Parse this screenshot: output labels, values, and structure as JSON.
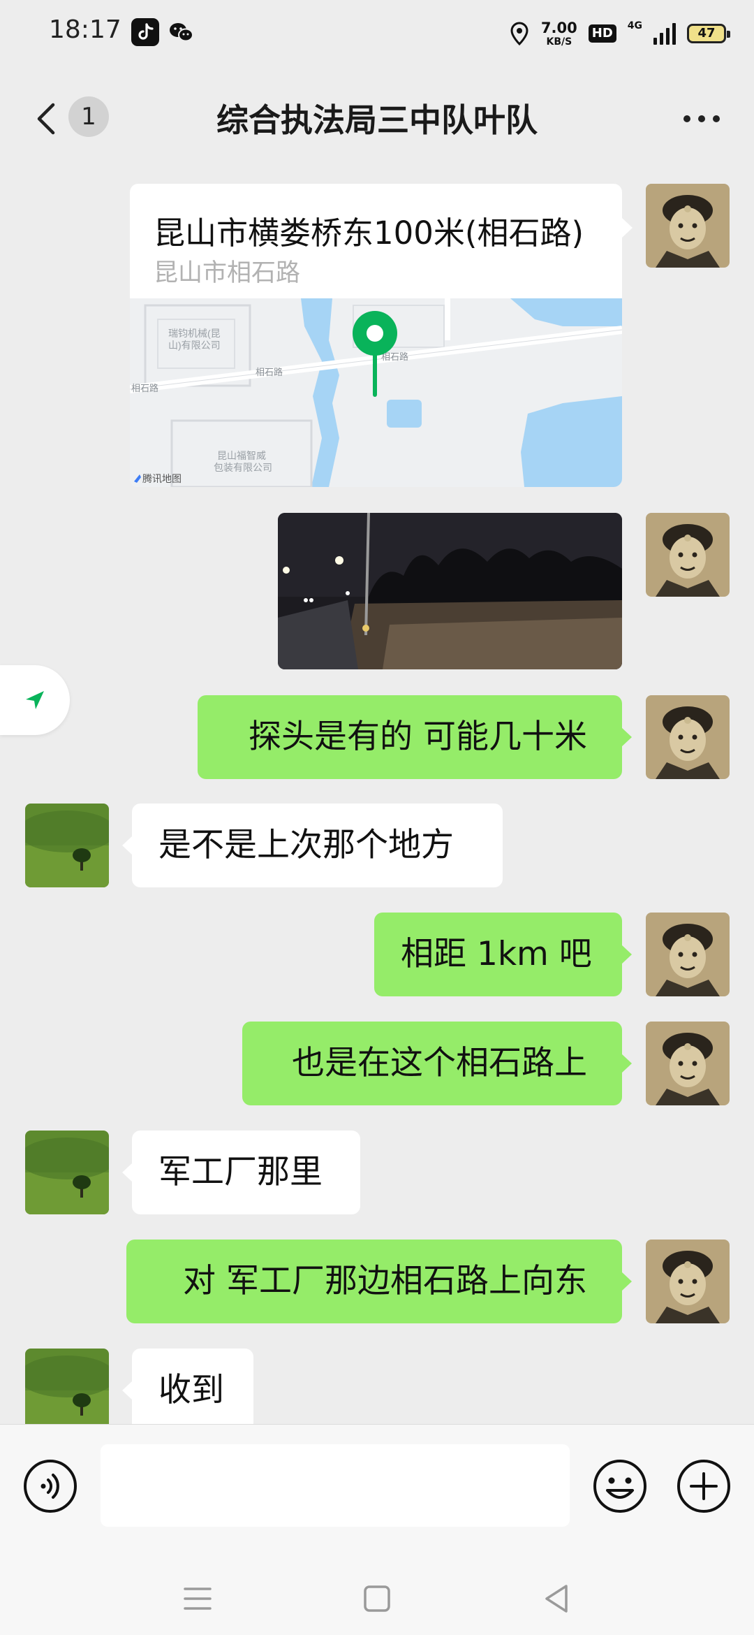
{
  "status_bar": {
    "time": "18:17",
    "speed_value": "7.00",
    "speed_unit": "KB/S",
    "hd_label": "HD",
    "network_label": "4G",
    "battery_level": "47",
    "icons": [
      "tiktok-icon",
      "wechat-icon",
      "location-icon",
      "signal-icon",
      "battery-icon"
    ]
  },
  "header": {
    "unread_count": "1",
    "title": "综合执法局三中队叶队"
  },
  "location_message": {
    "title": "昆山市横娄桥东100米(相石路)",
    "address": "昆山市相石路"
  },
  "messages": [
    {
      "sender": "me",
      "text": "探头是有的 可能几十米"
    },
    {
      "sender": "them",
      "text": "是不是上次那个地方"
    },
    {
      "sender": "me",
      "text": "相距 1km 吧"
    },
    {
      "sender": "me",
      "text": "也是在这个相石路上"
    },
    {
      "sender": "them",
      "text": "军工厂那里"
    },
    {
      "sender": "me",
      "text": "对 军工厂那边相石路上向东"
    },
    {
      "sender": "them",
      "text": "收到"
    }
  ],
  "input": {
    "value": "",
    "placeholder": ""
  },
  "colors": {
    "sent_bubble": "#95ec69",
    "received_bubble": "#ffffff",
    "chat_background": "#ededed",
    "map_pin": "#09b35a"
  }
}
